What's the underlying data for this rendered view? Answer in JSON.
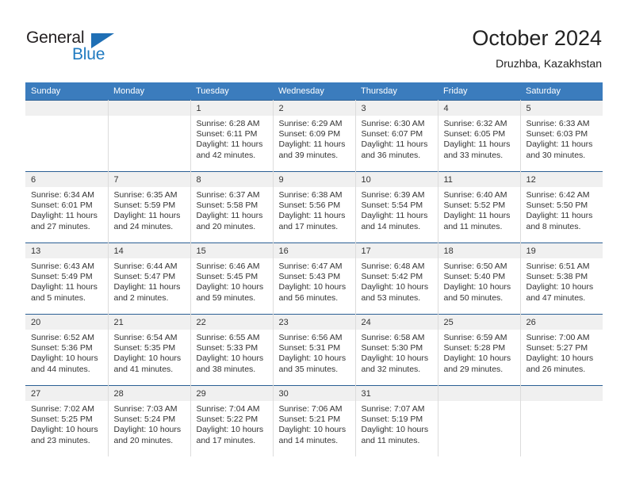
{
  "brand": {
    "name_top": "General",
    "name_bottom": "Blue",
    "triangle_color": "#1f6fb5",
    "blue_color": "#1f7ac0",
    "dark_color": "#231f20"
  },
  "header": {
    "title": "October 2024",
    "subtitle": "Druzhba, Kazakhstan"
  },
  "theme": {
    "header_bg": "#3b7cbd",
    "header_text": "#ffffff",
    "daynum_bg": "#f0f0f0",
    "row_border": "#2b5f94",
    "cell_border": "#dcdcdc"
  },
  "weekdays": [
    "Sunday",
    "Monday",
    "Tuesday",
    "Wednesday",
    "Thursday",
    "Friday",
    "Saturday"
  ],
  "labels": {
    "sunrise_prefix": "Sunrise:",
    "sunset_prefix": "Sunset:",
    "daylight_prefix": "Daylight:"
  },
  "weeks": [
    [
      {
        "day": ""
      },
      {
        "day": ""
      },
      {
        "day": "1",
        "sunrise": "Sunrise: 6:28 AM",
        "sunset": "Sunset: 6:11 PM",
        "daylight": "Daylight: 11 hours and 42 minutes."
      },
      {
        "day": "2",
        "sunrise": "Sunrise: 6:29 AM",
        "sunset": "Sunset: 6:09 PM",
        "daylight": "Daylight: 11 hours and 39 minutes."
      },
      {
        "day": "3",
        "sunrise": "Sunrise: 6:30 AM",
        "sunset": "Sunset: 6:07 PM",
        "daylight": "Daylight: 11 hours and 36 minutes."
      },
      {
        "day": "4",
        "sunrise": "Sunrise: 6:32 AM",
        "sunset": "Sunset: 6:05 PM",
        "daylight": "Daylight: 11 hours and 33 minutes."
      },
      {
        "day": "5",
        "sunrise": "Sunrise: 6:33 AM",
        "sunset": "Sunset: 6:03 PM",
        "daylight": "Daylight: 11 hours and 30 minutes."
      }
    ],
    [
      {
        "day": "6",
        "sunrise": "Sunrise: 6:34 AM",
        "sunset": "Sunset: 6:01 PM",
        "daylight": "Daylight: 11 hours and 27 minutes."
      },
      {
        "day": "7",
        "sunrise": "Sunrise: 6:35 AM",
        "sunset": "Sunset: 5:59 PM",
        "daylight": "Daylight: 11 hours and 24 minutes."
      },
      {
        "day": "8",
        "sunrise": "Sunrise: 6:37 AM",
        "sunset": "Sunset: 5:58 PM",
        "daylight": "Daylight: 11 hours and 20 minutes."
      },
      {
        "day": "9",
        "sunrise": "Sunrise: 6:38 AM",
        "sunset": "Sunset: 5:56 PM",
        "daylight": "Daylight: 11 hours and 17 minutes."
      },
      {
        "day": "10",
        "sunrise": "Sunrise: 6:39 AM",
        "sunset": "Sunset: 5:54 PM",
        "daylight": "Daylight: 11 hours and 14 minutes."
      },
      {
        "day": "11",
        "sunrise": "Sunrise: 6:40 AM",
        "sunset": "Sunset: 5:52 PM",
        "daylight": "Daylight: 11 hours and 11 minutes."
      },
      {
        "day": "12",
        "sunrise": "Sunrise: 6:42 AM",
        "sunset": "Sunset: 5:50 PM",
        "daylight": "Daylight: 11 hours and 8 minutes."
      }
    ],
    [
      {
        "day": "13",
        "sunrise": "Sunrise: 6:43 AM",
        "sunset": "Sunset: 5:49 PM",
        "daylight": "Daylight: 11 hours and 5 minutes."
      },
      {
        "day": "14",
        "sunrise": "Sunrise: 6:44 AM",
        "sunset": "Sunset: 5:47 PM",
        "daylight": "Daylight: 11 hours and 2 minutes."
      },
      {
        "day": "15",
        "sunrise": "Sunrise: 6:46 AM",
        "sunset": "Sunset: 5:45 PM",
        "daylight": "Daylight: 10 hours and 59 minutes."
      },
      {
        "day": "16",
        "sunrise": "Sunrise: 6:47 AM",
        "sunset": "Sunset: 5:43 PM",
        "daylight": "Daylight: 10 hours and 56 minutes."
      },
      {
        "day": "17",
        "sunrise": "Sunrise: 6:48 AM",
        "sunset": "Sunset: 5:42 PM",
        "daylight": "Daylight: 10 hours and 53 minutes."
      },
      {
        "day": "18",
        "sunrise": "Sunrise: 6:50 AM",
        "sunset": "Sunset: 5:40 PM",
        "daylight": "Daylight: 10 hours and 50 minutes."
      },
      {
        "day": "19",
        "sunrise": "Sunrise: 6:51 AM",
        "sunset": "Sunset: 5:38 PM",
        "daylight": "Daylight: 10 hours and 47 minutes."
      }
    ],
    [
      {
        "day": "20",
        "sunrise": "Sunrise: 6:52 AM",
        "sunset": "Sunset: 5:36 PM",
        "daylight": "Daylight: 10 hours and 44 minutes."
      },
      {
        "day": "21",
        "sunrise": "Sunrise: 6:54 AM",
        "sunset": "Sunset: 5:35 PM",
        "daylight": "Daylight: 10 hours and 41 minutes."
      },
      {
        "day": "22",
        "sunrise": "Sunrise: 6:55 AM",
        "sunset": "Sunset: 5:33 PM",
        "daylight": "Daylight: 10 hours and 38 minutes."
      },
      {
        "day": "23",
        "sunrise": "Sunrise: 6:56 AM",
        "sunset": "Sunset: 5:31 PM",
        "daylight": "Daylight: 10 hours and 35 minutes."
      },
      {
        "day": "24",
        "sunrise": "Sunrise: 6:58 AM",
        "sunset": "Sunset: 5:30 PM",
        "daylight": "Daylight: 10 hours and 32 minutes."
      },
      {
        "day": "25",
        "sunrise": "Sunrise: 6:59 AM",
        "sunset": "Sunset: 5:28 PM",
        "daylight": "Daylight: 10 hours and 29 minutes."
      },
      {
        "day": "26",
        "sunrise": "Sunrise: 7:00 AM",
        "sunset": "Sunset: 5:27 PM",
        "daylight": "Daylight: 10 hours and 26 minutes."
      }
    ],
    [
      {
        "day": "27",
        "sunrise": "Sunrise: 7:02 AM",
        "sunset": "Sunset: 5:25 PM",
        "daylight": "Daylight: 10 hours and 23 minutes."
      },
      {
        "day": "28",
        "sunrise": "Sunrise: 7:03 AM",
        "sunset": "Sunset: 5:24 PM",
        "daylight": "Daylight: 10 hours and 20 minutes."
      },
      {
        "day": "29",
        "sunrise": "Sunrise: 7:04 AM",
        "sunset": "Sunset: 5:22 PM",
        "daylight": "Daylight: 10 hours and 17 minutes."
      },
      {
        "day": "30",
        "sunrise": "Sunrise: 7:06 AM",
        "sunset": "Sunset: 5:21 PM",
        "daylight": "Daylight: 10 hours and 14 minutes."
      },
      {
        "day": "31",
        "sunrise": "Sunrise: 7:07 AM",
        "sunset": "Sunset: 5:19 PM",
        "daylight": "Daylight: 10 hours and 11 minutes."
      },
      {
        "day": ""
      },
      {
        "day": ""
      }
    ]
  ]
}
